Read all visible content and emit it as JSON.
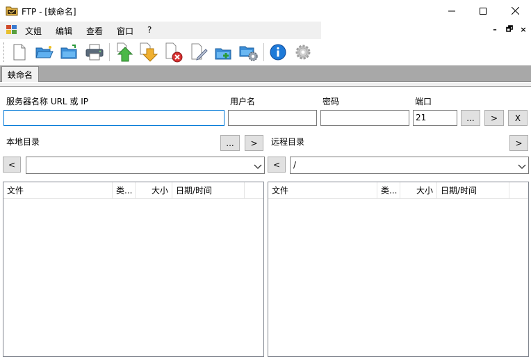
{
  "window": {
    "title": "FTP - [蛱命名]"
  },
  "menu": {
    "items": [
      "文姐",
      "编辑",
      "查看",
      "窗口",
      "?"
    ]
  },
  "mdi_controls": {
    "minimize": "–",
    "restore": "🗗",
    "close": "×"
  },
  "tabs": [
    {
      "label": "蛱命名",
      "active": true
    }
  ],
  "connection": {
    "server_label": "服务器名称 URL 或 IP",
    "server_value": "",
    "user_label": "用户名",
    "user_value": "",
    "password_label": "密码",
    "password_value": "",
    "port_label": "端口",
    "port_value": "21",
    "browse_label": "...",
    "connect_label": ">",
    "close_label": "X"
  },
  "local": {
    "label": "本地目录",
    "browse_label": "...",
    "go_label": ">",
    "back_label": "<",
    "path": "",
    "columns": [
      "文件",
      "类...",
      "大小",
      "日期/时间"
    ]
  },
  "remote": {
    "label": "远程目录",
    "go_label": ">",
    "back_label": "<",
    "path": "/",
    "columns": [
      "文件",
      "类...",
      "大小",
      "日期/时间"
    ]
  },
  "colors": {
    "accent": "#0078d7",
    "tab_strip": "#a8a8a8"
  }
}
